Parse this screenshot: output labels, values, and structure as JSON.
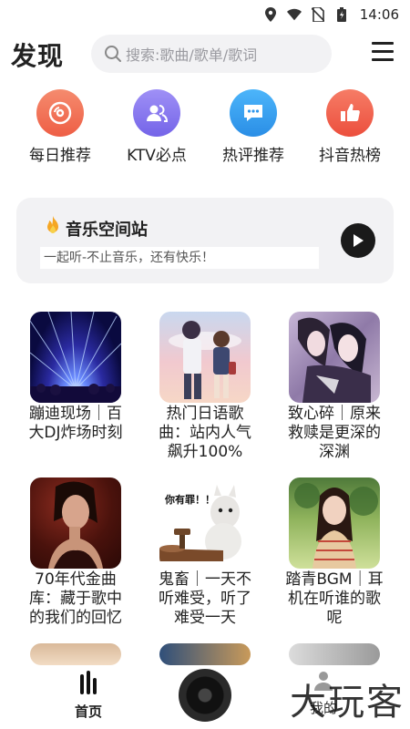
{
  "status_bar": {
    "time": "14:06"
  },
  "header": {
    "title": "发现",
    "search_placeholder": "搜索:歌曲/歌单/歌词"
  },
  "quick_nav": [
    {
      "label": "每日推荐",
      "icon": "disc-icon",
      "color": "#f2735a"
    },
    {
      "label": "KTV必点",
      "icon": "users-icon",
      "color": "#8a7cf0"
    },
    {
      "label": "热评推荐",
      "icon": "comment-icon",
      "color": "#3aa6f4"
    },
    {
      "label": "抖音热榜",
      "icon": "thumbs-up-icon",
      "color": "#f3644f"
    }
  ],
  "banner": {
    "title": "音乐空间站",
    "subtitle": "一起听-不止音乐，还有快乐！"
  },
  "playlists": [
    {
      "title": "蹦迪现场｜百大DJ炸场时刻"
    },
    {
      "title": "热门日语歌曲：站内人气飙升100%"
    },
    {
      "title": "致心碎｜原来救赎是更深的深渊"
    },
    {
      "title": "70年代金曲库：藏于歌中的我们的回忆"
    },
    {
      "title": "鬼畜｜一天不听难受，听了难受一天",
      "cover_caption": "你有罪！！"
    },
    {
      "title": "踏青BGM｜耳机在听谁的歌呢"
    }
  ],
  "bottom_nav": {
    "home_label": "首页",
    "mine_label": "我的"
  },
  "watermark": "大玩客"
}
